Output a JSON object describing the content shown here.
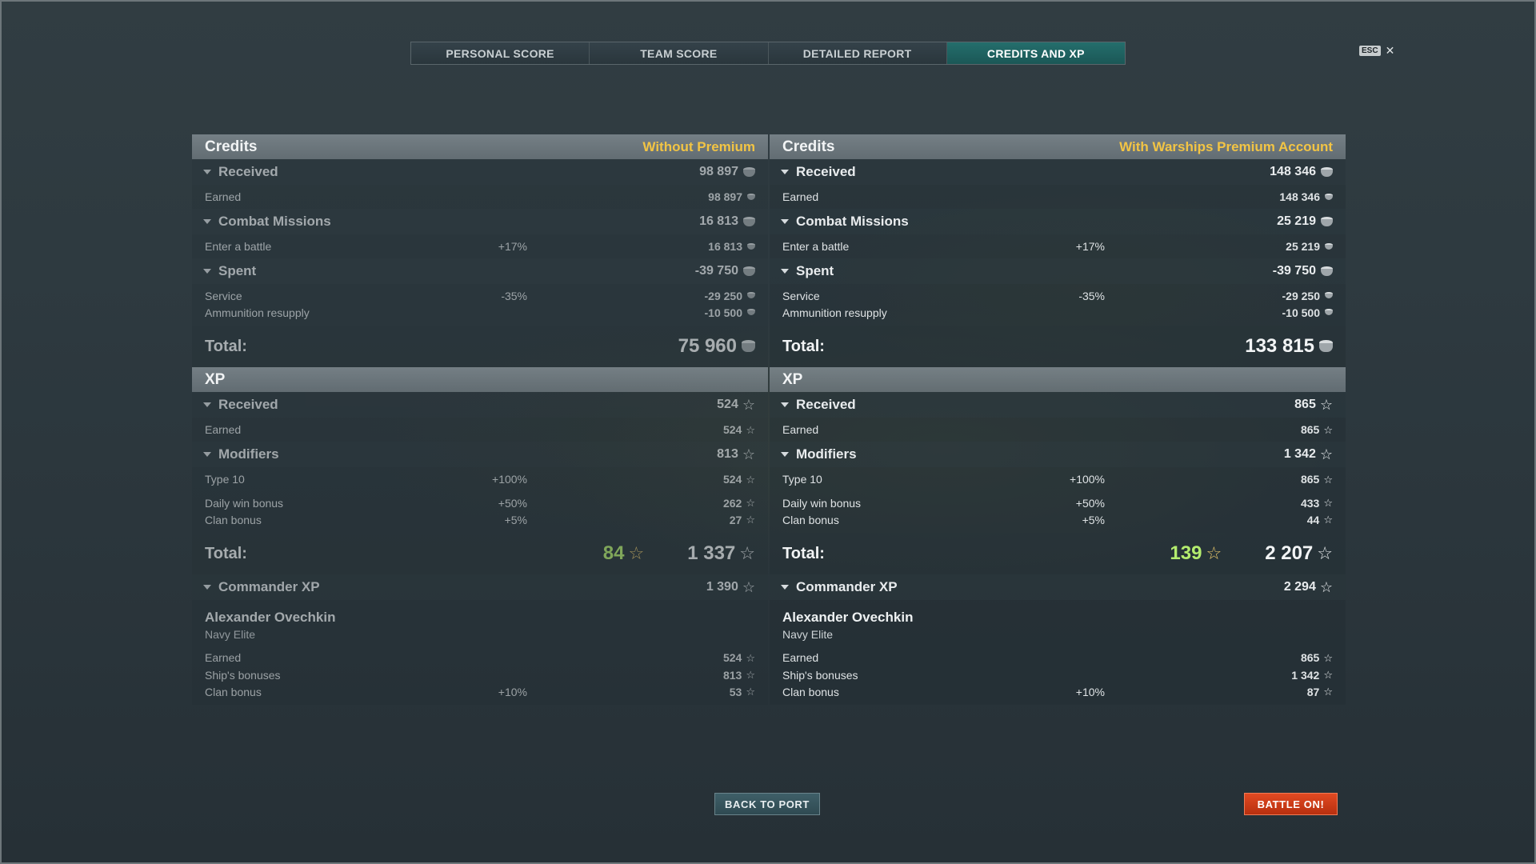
{
  "tabs": [
    {
      "label": "PERSONAL SCORE"
    },
    {
      "label": "TEAM SCORE"
    },
    {
      "label": "DETAILED REPORT"
    },
    {
      "label": "CREDITS AND XP",
      "active": true
    }
  ],
  "esc": {
    "key": "ESC",
    "close": "✕"
  },
  "left": {
    "credits_title": "Credits",
    "credits_subtitle": "Without Premium",
    "received_label": "Received",
    "received_value": "98 897",
    "earned_label": "Earned",
    "earned_value": "98 897",
    "missions_label": "Combat Missions",
    "missions_value": "16 813",
    "enter_label": "Enter a battle",
    "enter_pct": "+17%",
    "enter_value": "16 813",
    "spent_label": "Spent",
    "spent_value": "-39 750",
    "service_label": "Service",
    "service_pct": "-35%",
    "service_value": "-29 250",
    "ammo_label": "Ammunition resupply",
    "ammo_value": "-10 500",
    "credits_total_label": "Total:",
    "credits_total": "75 960",
    "xp_title": "XP",
    "xp_received_label": "Received",
    "xp_received_value": "524",
    "xp_earned_label": "Earned",
    "xp_earned_value": "524",
    "modifiers_label": "Modifiers",
    "modifiers_value": "813",
    "type10_label": "Type 10",
    "type10_pct": "+100%",
    "type10_value": "524",
    "daily_label": "Daily win bonus",
    "daily_pct": "+50%",
    "daily_value": "262",
    "clan_label": "Clan bonus",
    "clan_pct": "+5%",
    "clan_value": "27",
    "xp_total_label": "Total:",
    "xp_total_bonus": "84",
    "xp_total": "1 337",
    "cmd_label": "Commander XP",
    "cmd_value": "1 390",
    "cmd_name": "Alexander Ovechkin",
    "cmd_rank": "Navy Elite",
    "cmd_earned_label": "Earned",
    "cmd_earned_value": "524",
    "cmd_ship_label": "Ship's bonuses",
    "cmd_ship_value": "813",
    "cmd_clan_label": "Clan bonus",
    "cmd_clan_pct": "+10%",
    "cmd_clan_value": "53"
  },
  "right": {
    "credits_title": "Credits",
    "credits_subtitle": "With Warships Premium Account",
    "received_label": "Received",
    "received_value": "148 346",
    "earned_label": "Earned",
    "earned_value": "148 346",
    "missions_label": "Combat Missions",
    "missions_value": "25 219",
    "enter_label": "Enter a battle",
    "enter_pct": "+17%",
    "enter_value": "25 219",
    "spent_label": "Spent",
    "spent_value": "-39 750",
    "service_label": "Service",
    "service_pct": "-35%",
    "service_value": "-29 250",
    "ammo_label": "Ammunition resupply",
    "ammo_value": "-10 500",
    "credits_total_label": "Total:",
    "credits_total": "133 815",
    "xp_title": "XP",
    "xp_received_label": "Received",
    "xp_received_value": "865",
    "xp_earned_label": "Earned",
    "xp_earned_value": "865",
    "modifiers_label": "Modifiers",
    "modifiers_value": "1 342",
    "type10_label": "Type 10",
    "type10_pct": "+100%",
    "type10_value": "865",
    "daily_label": "Daily win bonus",
    "daily_pct": "+50%",
    "daily_value": "433",
    "clan_label": "Clan bonus",
    "clan_pct": "+5%",
    "clan_value": "44",
    "xp_total_label": "Total:",
    "xp_total_bonus": "139",
    "xp_total": "2 207",
    "cmd_label": "Commander XP",
    "cmd_value": "2 294",
    "cmd_name": "Alexander Ovechkin",
    "cmd_rank": "Navy Elite",
    "cmd_earned_label": "Earned",
    "cmd_earned_value": "865",
    "cmd_ship_label": "Ship's bonuses",
    "cmd_ship_value": "1 342",
    "cmd_clan_label": "Clan bonus",
    "cmd_clan_pct": "+10%",
    "cmd_clan_value": "87"
  },
  "buttons": {
    "back_to_port": "BACK TO PORT",
    "battle_on": "BATTLE ON!"
  },
  "colors": {
    "active_tab": "#1b5756",
    "premium_label": "#f2c444",
    "bonus_xp": "#b4ec6e",
    "battle_button": "#c9391a"
  },
  "icons": {
    "credits": "silver-coin-icon",
    "xp": "star-icon"
  }
}
